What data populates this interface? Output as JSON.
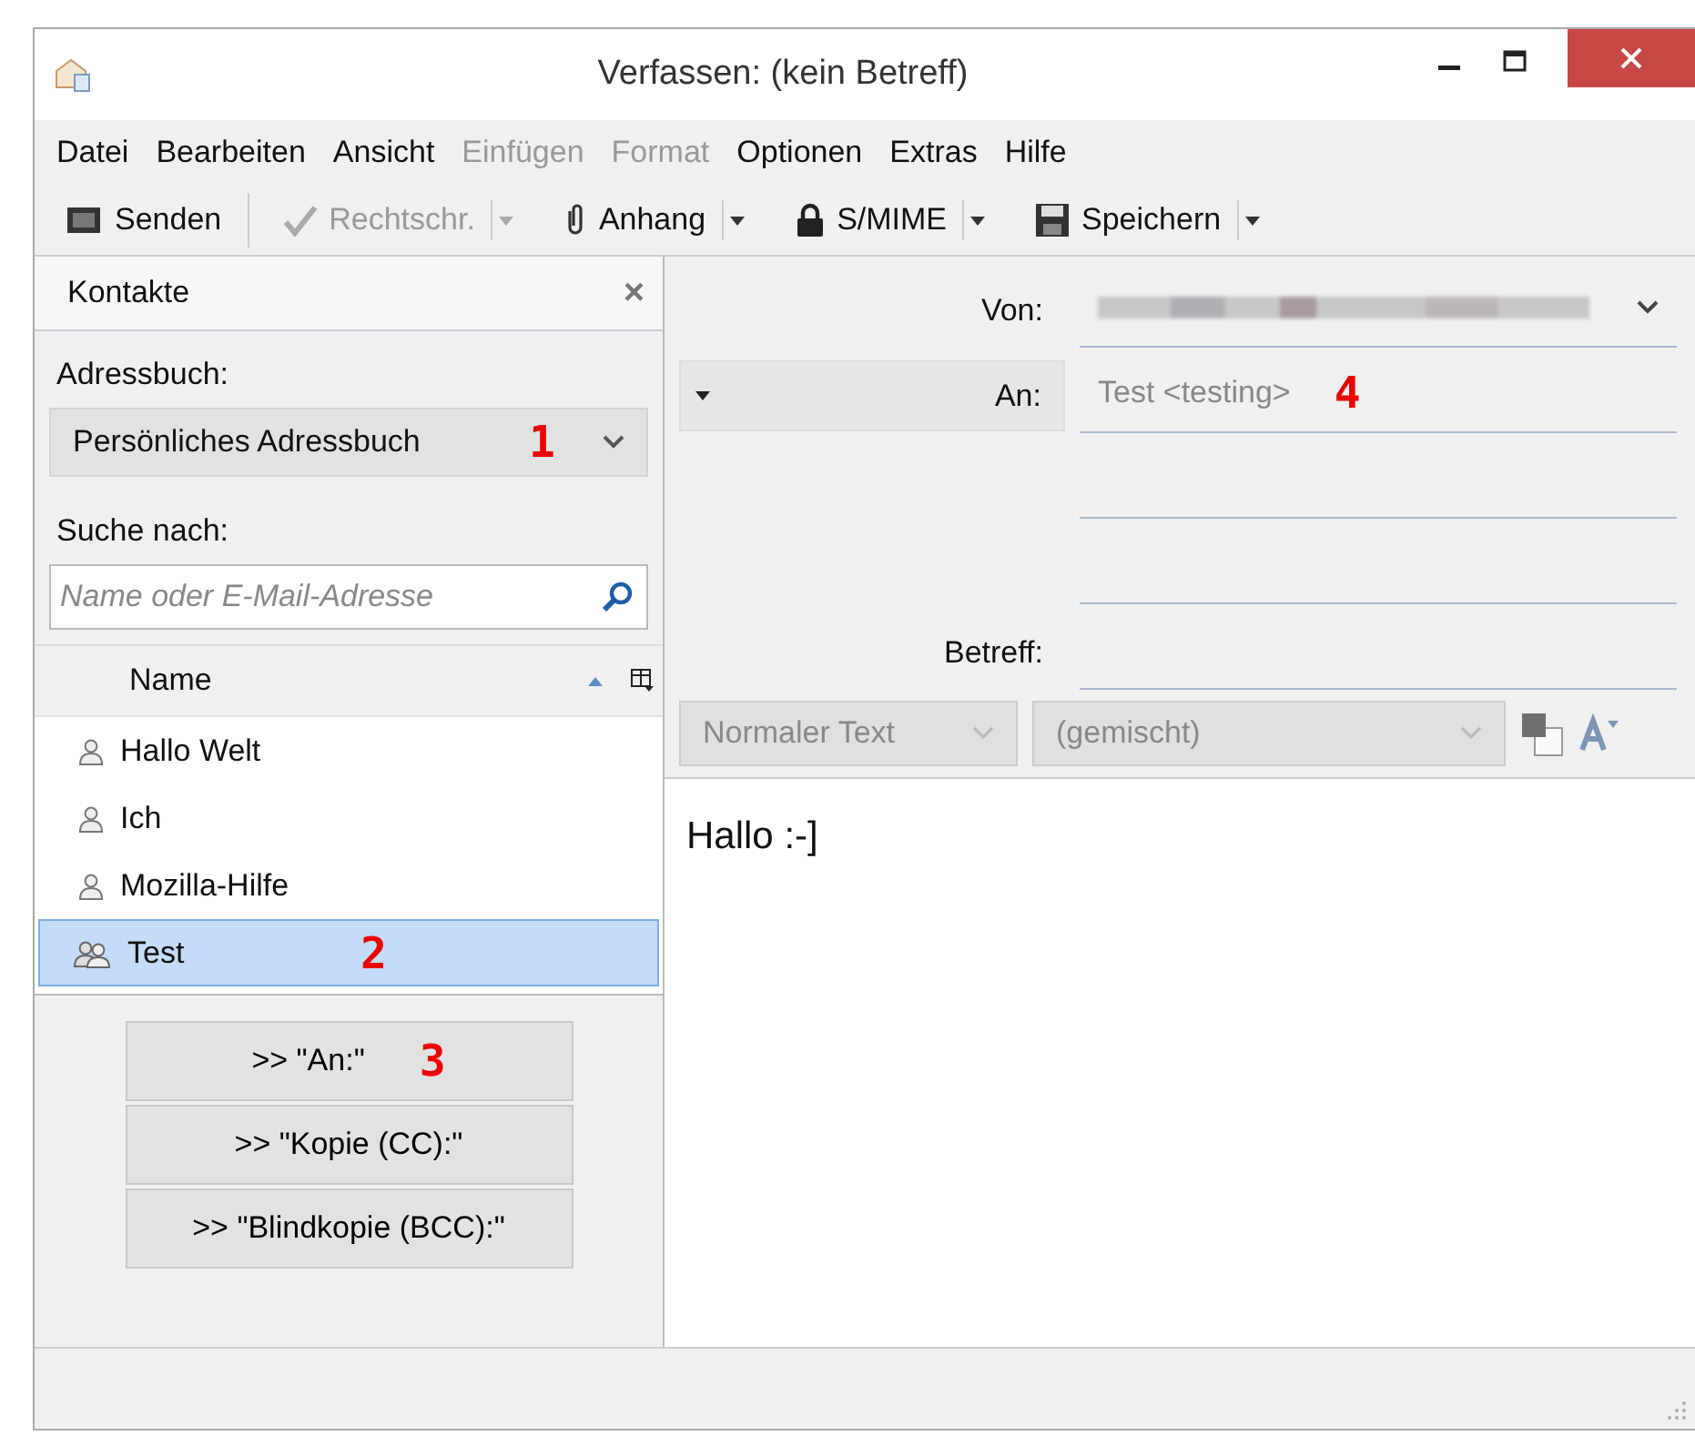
{
  "window": {
    "title": "Verfassen: (kein Betreff)"
  },
  "menu": [
    {
      "label": "Datei",
      "disabled": false
    },
    {
      "label": "Bearbeiten",
      "disabled": false
    },
    {
      "label": "Ansicht",
      "disabled": false
    },
    {
      "label": "Einfügen",
      "disabled": true
    },
    {
      "label": "Format",
      "disabled": true
    },
    {
      "label": "Optionen",
      "disabled": false
    },
    {
      "label": "Extras",
      "disabled": false
    },
    {
      "label": "Hilfe",
      "disabled": false
    }
  ],
  "toolbar": [
    {
      "kind": "send",
      "label": "Senden",
      "disabled": false
    },
    {
      "kind": "spell",
      "label": "Rechtschr.",
      "disabled": true,
      "dropdown": true
    },
    {
      "kind": "attach",
      "label": "Anhang",
      "disabled": false,
      "dropdown": true
    },
    {
      "kind": "lock",
      "label": "S/MIME",
      "disabled": false,
      "dropdown": true
    },
    {
      "kind": "save",
      "label": "Speichern",
      "disabled": false,
      "dropdown": true
    }
  ],
  "sidebar": {
    "title": "Kontakte",
    "close": "×",
    "addressbook_label": "Adressbuch:",
    "addressbook": "Persönliches Adressbuch",
    "addressbook_marker": "1",
    "search_label": "Suche nach:",
    "search": {
      "placeholder": "Name oder E-Mail-Adresse"
    },
    "column": "Name",
    "contacts": [
      {
        "name": "Hallo Welt",
        "kind": "person",
        "selected": false
      },
      {
        "name": "Ich",
        "kind": "person",
        "selected": false
      },
      {
        "name": "Mozilla-Hilfe",
        "kind": "person",
        "selected": false
      },
      {
        "name": "Test",
        "kind": "group",
        "selected": true,
        "marker": "2"
      }
    ],
    "buttons": [
      {
        "label": ">> \"An:\"",
        "marker": "3"
      },
      {
        "label": ">> \"Kopie (CC):\""
      },
      {
        "label": ">> \"Blindkopie (BCC):\""
      }
    ]
  },
  "header": {
    "from_label": "Von:",
    "to_label": "An:",
    "to_value": "Test <testing>",
    "to_marker": "4",
    "subject_label": "Betreff:"
  },
  "format_bar": {
    "paragraph": "Normaler Text",
    "font": "(gemischt)"
  },
  "body": "Hallo :-]"
}
